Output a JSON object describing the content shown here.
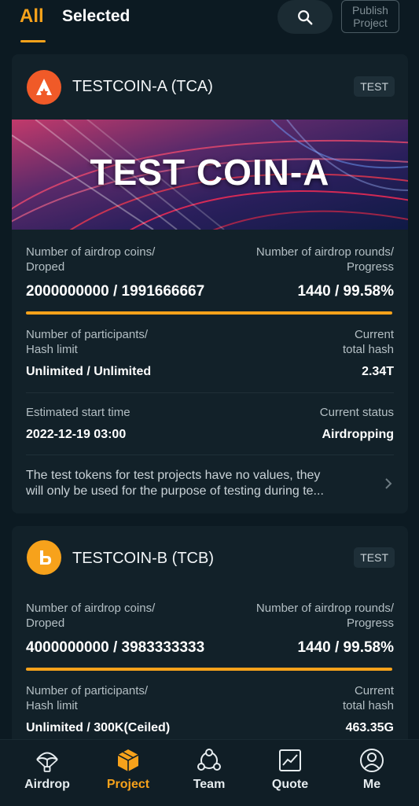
{
  "tabs": {
    "all": "All",
    "selected": "Selected"
  },
  "publish_button": "Publish Project",
  "labels": {
    "coins": [
      "Number of airdrop coins/",
      "Droped"
    ],
    "rounds": [
      "Number of airdrop rounds/",
      "Progress"
    ],
    "participants": [
      "Number of participants/",
      "Hash limit"
    ],
    "hash": [
      "Current",
      "total hash"
    ],
    "start": "Estimated start time",
    "status": "Current status"
  },
  "cards": [
    {
      "name": "TESTCOIN-A (TCA)",
      "badge": "TEST",
      "banner_text_1": "TEST",
      "banner_text_2": "COIN-A",
      "coins_value": "2000000000 / 1991666667",
      "rounds_value": "1440 / 99.58%",
      "progress": 0.9958,
      "participants_value": "Unlimited / Unlimited",
      "hash_value": "2.34T",
      "start_value": "2022-12-19 03:00",
      "status_value": "Airdropping",
      "notice_line_1": "The test tokens for test projects have no values, they",
      "notice_line_2": "will only be used for the purpose of testing during te..."
    },
    {
      "name": "TESTCOIN-B (TCB)",
      "badge": "TEST",
      "coins_value": "4000000000 / 3983333333",
      "rounds_value": "1440 / 99.58%",
      "progress": 0.9958,
      "participants_value": "Unlimited / 300K(Ceiled)",
      "hash_value": "463.35G"
    }
  ],
  "nav": [
    {
      "label": "Airdrop",
      "icon": "parachute-icon"
    },
    {
      "label": "Project",
      "icon": "cube-icon",
      "active": true
    },
    {
      "label": "Team",
      "icon": "team-icon"
    },
    {
      "label": "Quote",
      "icon": "chart-icon"
    },
    {
      "label": "Me",
      "icon": "user-icon"
    }
  ],
  "colors": {
    "accent": "#f7a21b",
    "background": "#0c1a22",
    "card": "#122129"
  }
}
